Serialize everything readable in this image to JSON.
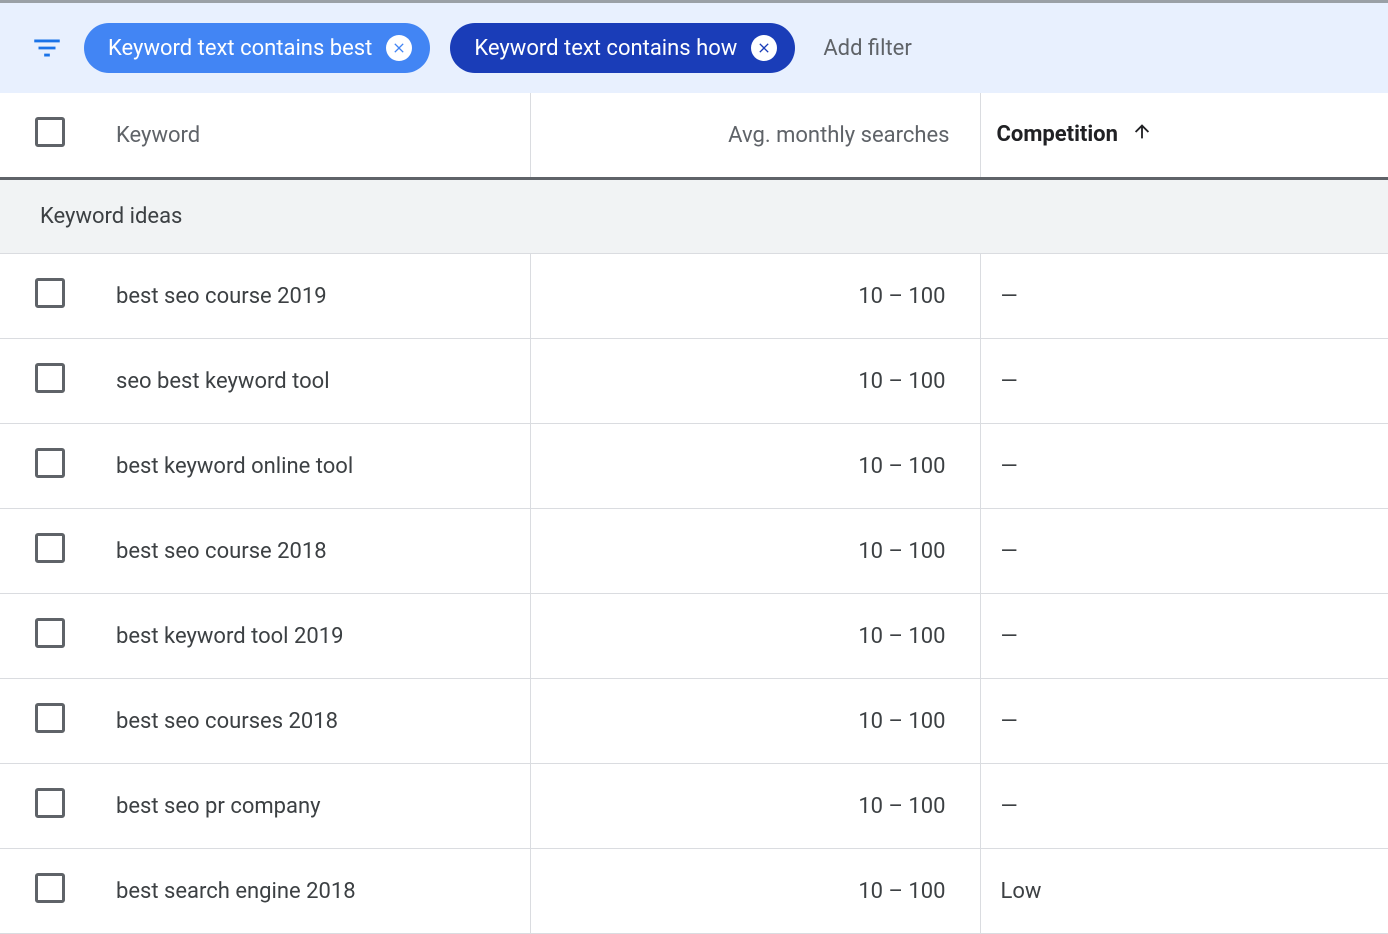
{
  "filterBar": {
    "chips": [
      {
        "label": "Keyword text contains best",
        "style": "light"
      },
      {
        "label": "Keyword text contains how",
        "style": "dark"
      }
    ],
    "addFilterLabel": "Add filter"
  },
  "table": {
    "columns": {
      "keyword": "Keyword",
      "searches": "Avg. monthly searches",
      "competition": "Competition"
    },
    "sectionTitle": "Keyword ideas",
    "rows": [
      {
        "keyword": "best seo course 2019",
        "searches": "10 – 100",
        "competition": "—"
      },
      {
        "keyword": "seo best keyword tool",
        "searches": "10 – 100",
        "competition": "—"
      },
      {
        "keyword": "best keyword online tool",
        "searches": "10 – 100",
        "competition": "—"
      },
      {
        "keyword": "best seo course 2018",
        "searches": "10 – 100",
        "competition": "—"
      },
      {
        "keyword": "best keyword tool 2019",
        "searches": "10 – 100",
        "competition": "—"
      },
      {
        "keyword": "best seo courses 2018",
        "searches": "10 – 100",
        "competition": "—"
      },
      {
        "keyword": "best seo pr company",
        "searches": "10 – 100",
        "competition": "—"
      },
      {
        "keyword": "best search engine 2018",
        "searches": "10 – 100",
        "competition": "Low"
      }
    ]
  }
}
